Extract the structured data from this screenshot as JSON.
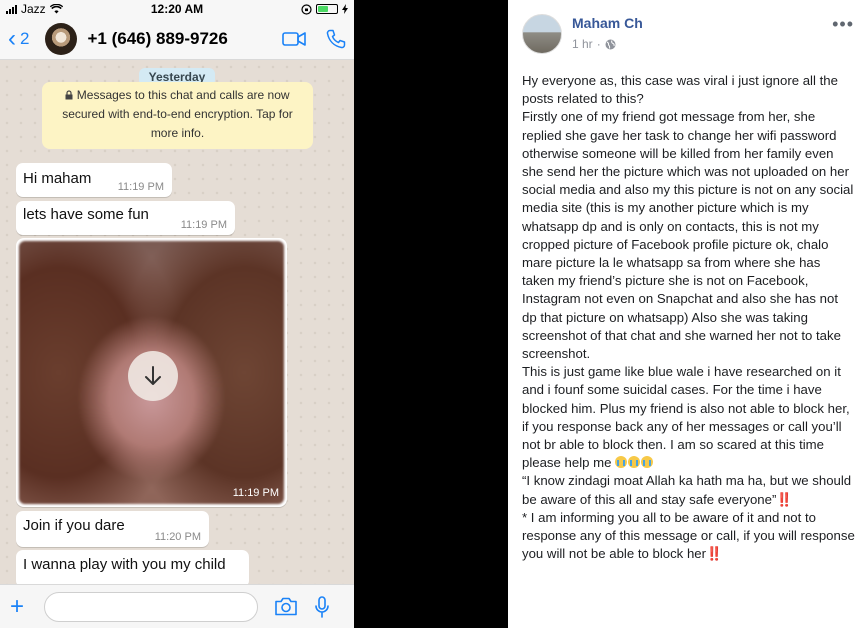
{
  "status_bar": {
    "carrier": "Jazz",
    "time": "12:20 AM"
  },
  "chat_header": {
    "back_count": "2",
    "contact": "+1 (646) 889-9726"
  },
  "chat": {
    "date_label": "Yesterday",
    "encryption_notice": "Messages to this chat and calls are now secured with end-to-end encryption. Tap for more info.",
    "messages": [
      {
        "text": "Hi maham",
        "time": "11:19 PM"
      },
      {
        "text": "lets have some fun",
        "time": "11:19 PM"
      },
      {
        "text": "Join if you dare",
        "time": "11:20 PM"
      },
      {
        "text": "I wanna play with you my child",
        "time": ""
      }
    ],
    "media_time": "11:19 PM"
  },
  "composer": {
    "placeholder": ""
  },
  "post": {
    "author": "Maham Ch",
    "time": "1 hr",
    "more": "•••",
    "text_before_emoji": "Hy everyone as, this case was viral i just ignore all the posts related to this?\nFirstly one of my friend got message from her, she replied she gave her task to change her wifi password otherwise someone will be killed from her family even she send her the picture which was not uploaded on her social media and also my this picture is not on any social media site (this is my another picture which is my whatsapp dp and is only on contacts, this is not my cropped picture of Facebook profile picture ok, chalo mare picture la le whatsapp sa from where she has taken my friend’s picture she is not on Facebook, Instagram not even on Snapchat and also she has not dp that picture on whatsapp) Also she was taking screenshot of that chat and she warned her not to take screenshot.\nThis is just game like blue wale i have researched on it and i founf some suicidal cases. For the time i have blocked him. Plus my friend is also not able to block her, if you response back any of her messages or call you’ll not br able to block then. I am so scared at this time please help me",
    "emoji": "crying-face",
    "text_after_emoji": "“I know zindagi moat Allah ka hath ma ha, but we should be aware of this all and stay safe everyone”‼️\n* I am informing you all to be aware of it and not to response any of this message or call, if you will response you will not be able to block her‼️"
  },
  "colors": {
    "ios_blue": "#1a82f7",
    "fb_link": "#385898",
    "chat_bg": "#e5ddd5",
    "notice_bg": "#fdf4c5"
  }
}
